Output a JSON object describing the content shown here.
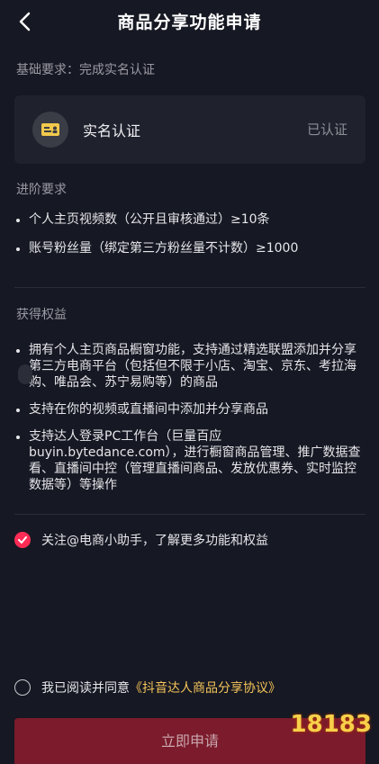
{
  "header": {
    "title": "商品分享功能申请"
  },
  "basic": {
    "label": "基础要求：完成实名认证",
    "card_label": "实名认证",
    "card_status": "已认证"
  },
  "advanced": {
    "label": "进阶要求",
    "items": [
      "个人主页视频数（公开且审核通过）≥10条",
      "账号粉丝量（绑定第三方粉丝量不计数）≥1000"
    ]
  },
  "benefits": {
    "label": "获得权益",
    "items": [
      "拥有个人主页商品橱窗功能，支持通过精选联盟添加并分享第三方电商平台（包括但不限于小店、淘宝、京东、考拉海购、唯品会、苏宁易购等）的商品",
      "支持在你的视频或直播间中添加并分享商品",
      "支持达人登录PC工作台（巨量百应buyin.bytedance.com），进行橱窗商品管理、推广数据查看、直播间中控（管理直播间商品、发放优惠券、实时监控数据等）等操作"
    ]
  },
  "follow": {
    "label": "关注@电商小助手，了解更多功能和权益",
    "checked": true
  },
  "agreement": {
    "prefix": "我已阅读并同意",
    "link": "《抖音达人商品分享协议》",
    "checked": false
  },
  "submit": {
    "label": "立即申请"
  },
  "watermark": {
    "text": "18183"
  },
  "colors": {
    "accent": "#fe2c55",
    "link": "#f5c45a",
    "background": "#161823"
  }
}
